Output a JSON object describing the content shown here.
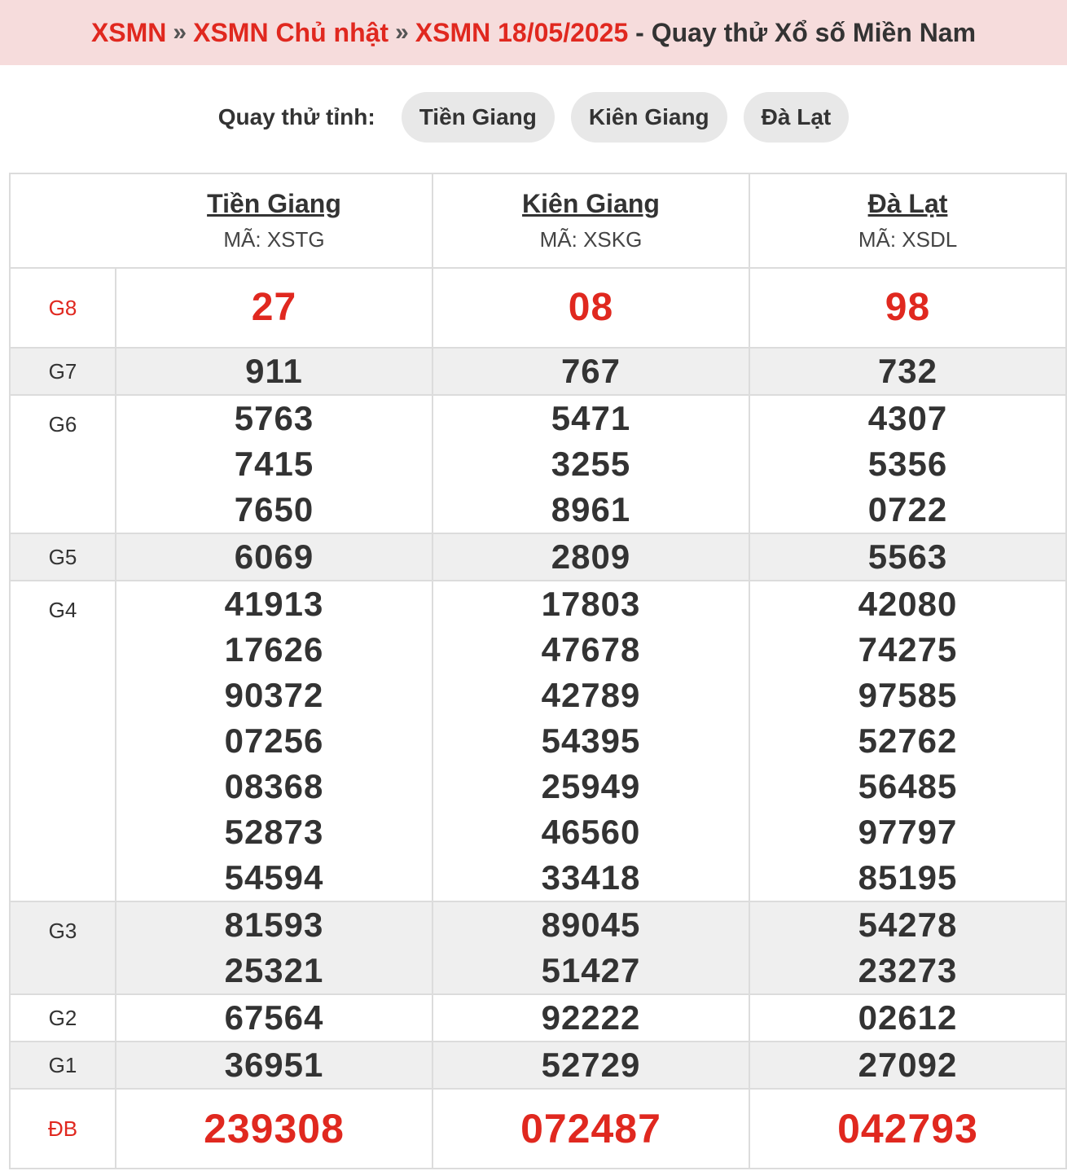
{
  "breadcrumb": {
    "items": [
      "XSMN",
      "XSMN Chủ nhật",
      "XSMN 18/05/2025"
    ],
    "separator": "»",
    "title_suffix": "- Quay thử Xổ số Miền Nam"
  },
  "picker": {
    "label": "Quay thử tỉnh:",
    "options": [
      "Tiền Giang",
      "Kiên Giang",
      "Đà Lạt"
    ]
  },
  "provinces": [
    {
      "name": "Tiền Giang",
      "code": "MÃ: XSTG"
    },
    {
      "name": "Kiên Giang",
      "code": "MÃ: XSKG"
    },
    {
      "name": "Đà Lạt",
      "code": "MÃ: XSDL"
    }
  ],
  "prizes": [
    {
      "label": "G8",
      "results": [
        [
          "27"
        ],
        [
          "08"
        ],
        [
          "98"
        ]
      ]
    },
    {
      "label": "G7",
      "results": [
        [
          "911"
        ],
        [
          "767"
        ],
        [
          "732"
        ]
      ]
    },
    {
      "label": "G6",
      "results": [
        [
          "5763",
          "7415",
          "7650"
        ],
        [
          "5471",
          "3255",
          "8961"
        ],
        [
          "4307",
          "5356",
          "0722"
        ]
      ]
    },
    {
      "label": "G5",
      "results": [
        [
          "6069"
        ],
        [
          "2809"
        ],
        [
          "5563"
        ]
      ]
    },
    {
      "label": "G4",
      "results": [
        [
          "41913",
          "17626",
          "90372",
          "07256",
          "08368",
          "52873",
          "54594"
        ],
        [
          "17803",
          "47678",
          "42789",
          "54395",
          "25949",
          "46560",
          "33418"
        ],
        [
          "42080",
          "74275",
          "97585",
          "52762",
          "56485",
          "97797",
          "85195"
        ]
      ]
    },
    {
      "label": "G3",
      "results": [
        [
          "81593",
          "25321"
        ],
        [
          "89045",
          "51427"
        ],
        [
          "54278",
          "23273"
        ]
      ]
    },
    {
      "label": "G2",
      "results": [
        [
          "67564"
        ],
        [
          "92222"
        ],
        [
          "02612"
        ]
      ]
    },
    {
      "label": "G1",
      "results": [
        [
          "36951"
        ],
        [
          "52729"
        ],
        [
          "27092"
        ]
      ]
    },
    {
      "label": "ĐB",
      "results": [
        [
          "239308"
        ],
        [
          "072487"
        ],
        [
          "042793"
        ]
      ]
    }
  ],
  "colors": {
    "accent_red": "#e0281f",
    "header_bg": "#f6dcdc",
    "row_shade": "#efefef"
  }
}
